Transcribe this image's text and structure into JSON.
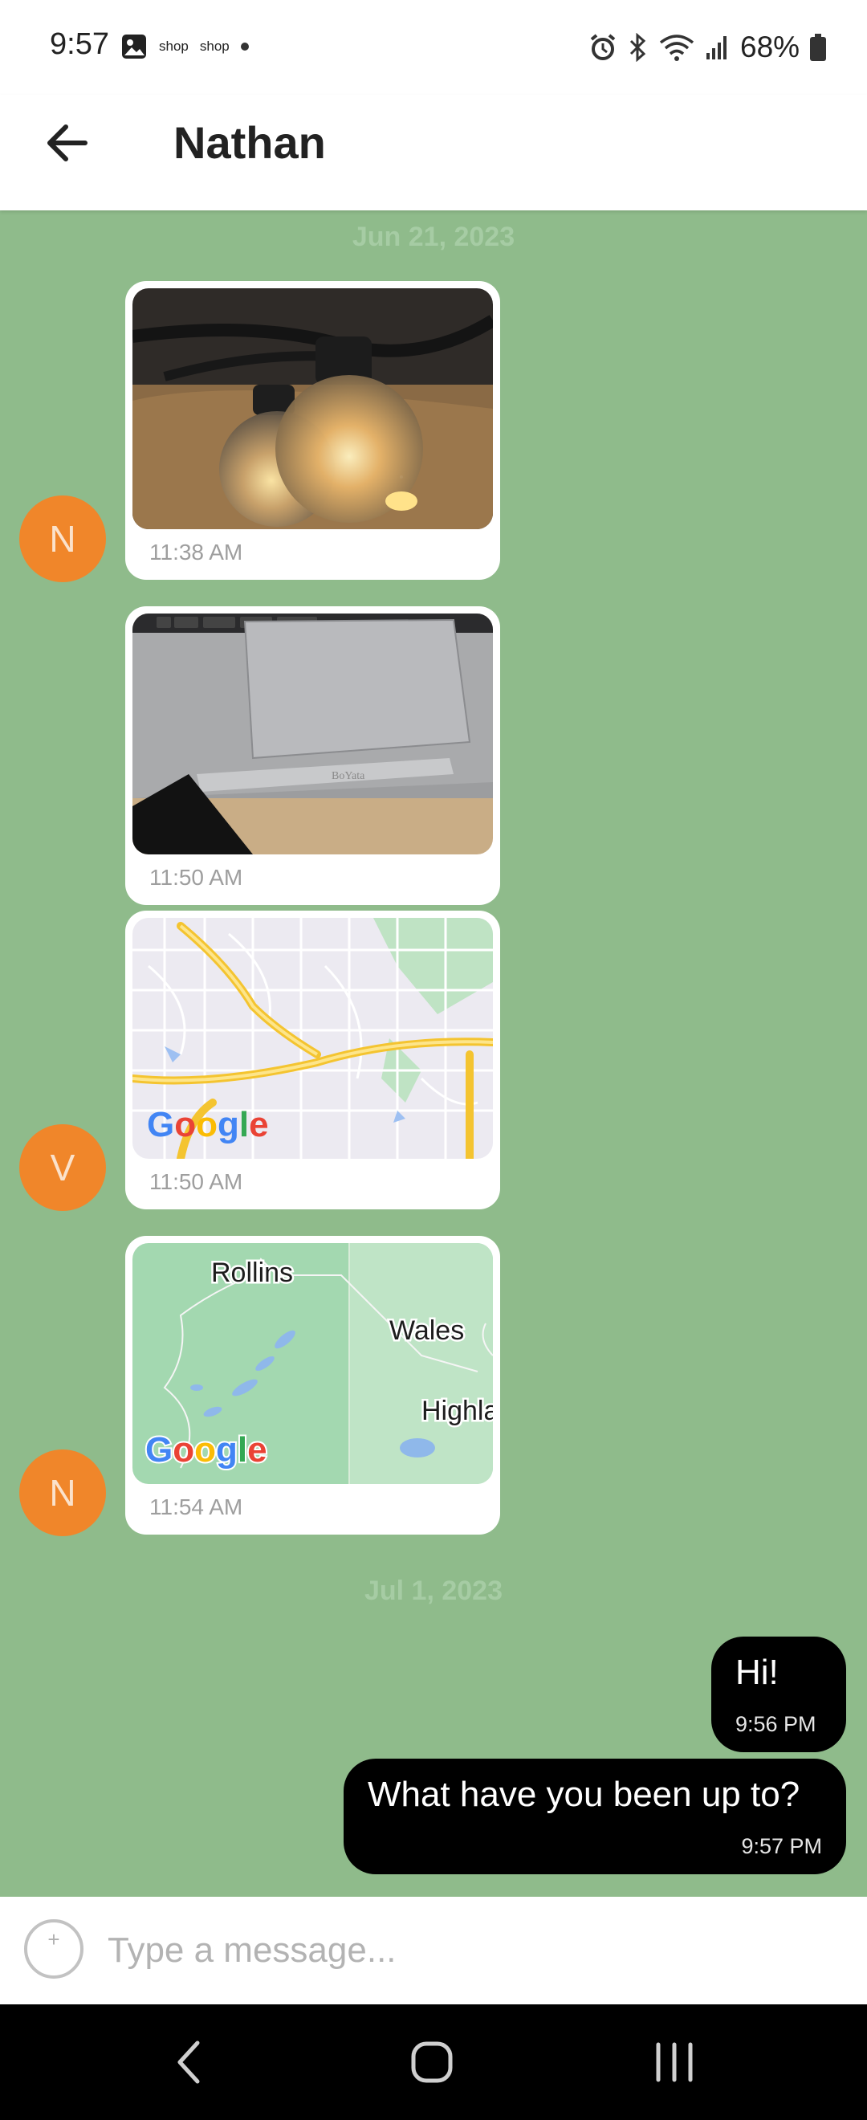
{
  "status_bar": {
    "time": "9:57",
    "notification_labels": [
      "shop",
      "shop"
    ],
    "battery": "68%"
  },
  "header": {
    "title": "Nathan"
  },
  "messages": {
    "date_1": "Jun 21, 2023",
    "date_2": "Jul 1, 2023",
    "image_messages": [
      {
        "avatar": "N",
        "time": "11:38 AM"
      },
      {
        "avatar": "",
        "time": "11:50 AM"
      },
      {
        "avatar": "V",
        "time": "11:50 AM"
      },
      {
        "avatar": "N",
        "time": "11:54 AM"
      }
    ],
    "map_1": {
      "logo": "Google"
    },
    "map_2": {
      "logo": "Google",
      "labels": [
        "Rollins",
        "Wales",
        "Highla"
      ]
    },
    "laptop_stand_label": "BoYata",
    "outgoing": [
      {
        "text": "Hi!",
        "time": "9:56 PM"
      },
      {
        "text": "What have you been up to?",
        "time": "9:57 PM"
      }
    ]
  },
  "input": {
    "placeholder": "Type a message..."
  },
  "colors": {
    "chat_background": "#8fbb8b",
    "avatar": "#f0862a",
    "outgoing_bubble": "#000000"
  }
}
